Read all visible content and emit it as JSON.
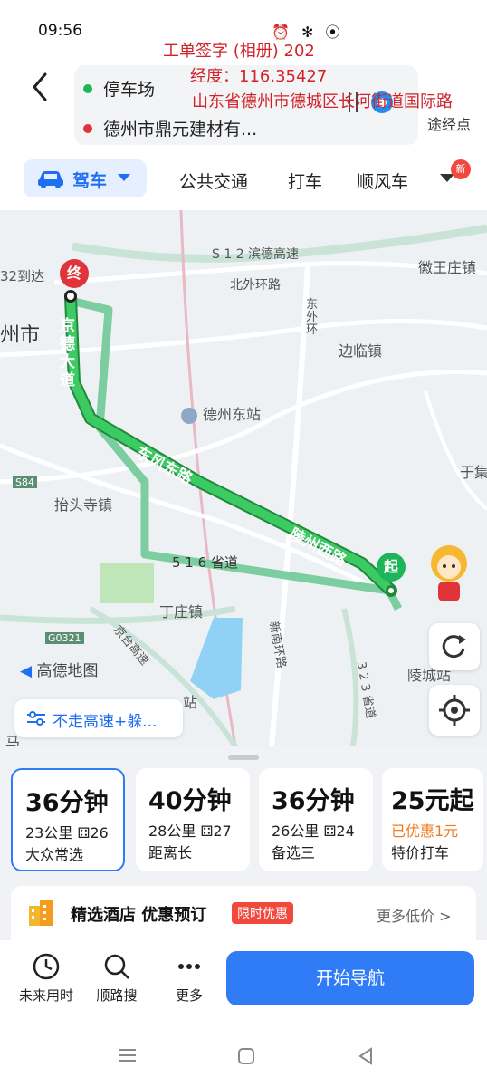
{
  "status": {
    "time": "09:56",
    "icons": "⏰ ✻ ⦿"
  },
  "watermark": {
    "line1": "工单签字 (相册)  202",
    "line2": "经度：116.35427",
    "line3": "山东省德州市德城区长河街道国际路"
  },
  "route": {
    "start": "停车场",
    "end": "德州市鼎元建材有...",
    "via_label": "途经点",
    "start_color": "#1eb55a",
    "end_color": "#e0343a"
  },
  "modes": {
    "drive": "驾车",
    "transit": "公共交通",
    "taxi": "打车",
    "carpool": "顺风车",
    "new_badge": "新"
  },
  "map": {
    "labels": {
      "s12": "S 1 2 滨德高速",
      "north_ring": "北外环路",
      "dongwai": "东外环",
      "huiwang": "徽王庄镇",
      "dezhou_city": "州市",
      "bianlin": "边临镇",
      "dezhou_east": "德州东站",
      "yuji": "于集",
      "taitousi": "抬头寺镇",
      "s84": "S84",
      "dingzhuang": "丁庄镇",
      "g0321": "G0321",
      "jingtai": "京台高速",
      "xinnan": "新南环路",
      "road_516": "5 1 6 省道",
      "road_323": "3 2 3 省道",
      "lingxian": "陵城站",
      "station": "站",
      "daoda": "32到达",
      "ma": "马",
      "amap_logo": "高德地图",
      "jingde": "京德大道",
      "dongfeng": "东风东路",
      "lingzhou": "陵州西路"
    },
    "end_marker": "终",
    "start_marker": "起",
    "route_color": "#2fbf5b",
    "filter_chip": "不走高速+躲..."
  },
  "routes": [
    {
      "time": "36分钟",
      "dist": "23公里",
      "lights": "26",
      "tag": "大众常选",
      "selected": true
    },
    {
      "time": "40分钟",
      "dist": "28公里",
      "lights": "27",
      "tag": "距离长",
      "selected": false
    },
    {
      "time": "36分钟",
      "dist": "26公里",
      "lights": "24",
      "tag": "备选三",
      "selected": false
    }
  ],
  "taxi_card": {
    "price": "25元起",
    "discount": "已优惠1元",
    "tag": "特价打车"
  },
  "hotel": {
    "title": "精选酒店 优惠预订",
    "badge": "限时优惠",
    "more": "更多低价 >"
  },
  "bottom": {
    "future": "未来用时",
    "search": "顺路搜",
    "more": "更多",
    "start": "开始导航"
  }
}
